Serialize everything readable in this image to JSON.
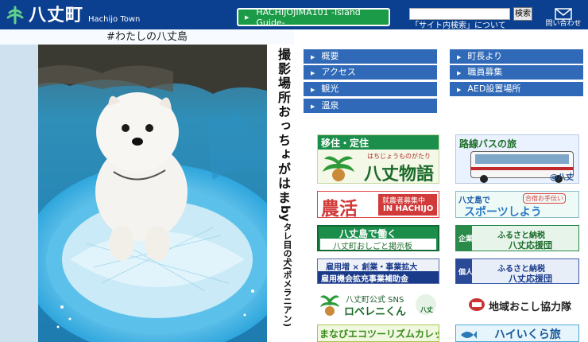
{
  "header": {
    "logo_text": "八丈町",
    "logo_sub": "Hachijo Town",
    "guide_button": "HACHIJOJIMA101 -Island Guide-",
    "search_button": "検索",
    "search_about": "「サイト内検索」について",
    "contact_label": "問い合わせ"
  },
  "photo": {
    "caption": "#わたしの八丈島",
    "location": "撮影場所おっちょがはま",
    "by": "by",
    "credit": "タレ目の犬(ポメラニアン)"
  },
  "menu": {
    "left": [
      "概要",
      "アクセス",
      "観光",
      "温泉"
    ],
    "right": [
      "町長より",
      "職員募集",
      "AED設置場所"
    ]
  },
  "banners": {
    "iju": {
      "line1": "移住・定住",
      "line2": "はちじょうものがたり",
      "line3": "八丈物語"
    },
    "bus": {
      "line1": "路線バスの旅",
      "line2": "@八丈"
    },
    "noukatsu": {
      "line1": "農活",
      "line2": "就農者募集中",
      "line3": "IN HACHIJO"
    },
    "sports": {
      "line1": "八丈島で",
      "line2": "合宿お手伝い",
      "line3": "スポーツしよう"
    },
    "work": {
      "line1": "八丈島で働く",
      "line2": "八丈町おしごと掲示板"
    },
    "furusato_corp": {
      "tag": "企業",
      "line1": "ふるさと納税",
      "line2": "八丈応援団"
    },
    "koyou": {
      "line1": "雇用増 × 創業・事業拡大",
      "line2": "雇用機会拡充事業補助金"
    },
    "furusato_ind": {
      "tag": "個人",
      "line1": "ふるさと納税",
      "line2": "八丈応援団"
    },
    "sns": {
      "line1": "八丈町公式 SNS",
      "line2": "ロベレニくん",
      "line3": "八丈"
    },
    "chiiki": {
      "line1": "地域おこし協力隊"
    },
    "eco": {
      "line1": "まなびエコツーリズムカレッジ"
    },
    "ikura": {
      "line1": "ハイいくら旅"
    }
  },
  "colors": {
    "header_bg": "#0b3f8f",
    "guide_btn": "#1b9a47",
    "menu_btn": "#2f69b7"
  }
}
